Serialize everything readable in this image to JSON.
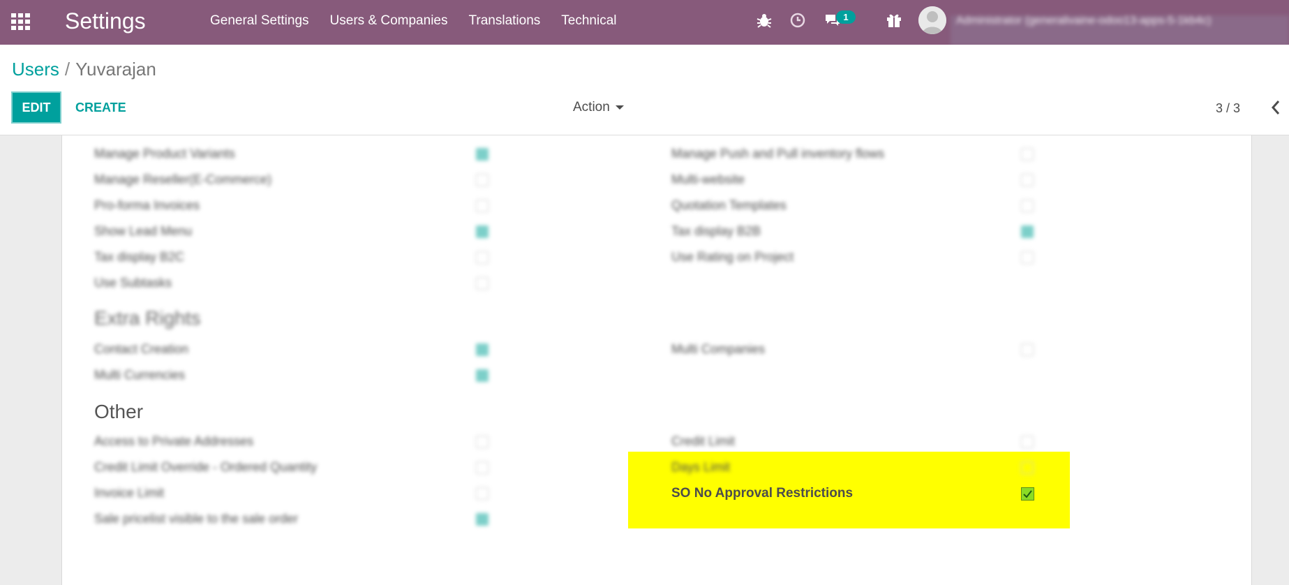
{
  "navbar": {
    "app_title": "Settings",
    "menu": [
      "General Settings",
      "Users & Companies",
      "Translations",
      "Technical"
    ],
    "chat_badge": "1",
    "user_name": "Administrator (generalivaine-odoo13-apps-5-1kb4c)"
  },
  "breadcrumb": {
    "parent": "Users",
    "separator": "/",
    "current": "Yuvarajan"
  },
  "toolbar": {
    "edit_label": "EDIT",
    "create_label": "CREATE",
    "action_label": "Action",
    "pager": "3 / 3"
  },
  "rights": {
    "left": [
      {
        "label": "Manage Product Variants",
        "checked": true
      },
      {
        "label": "Manage Reseller(E-Commerce)",
        "checked": false
      },
      {
        "label": "Pro-forma Invoices",
        "checked": false
      },
      {
        "label": "Show Lead Menu",
        "checked": true
      },
      {
        "label": "Tax display B2C",
        "checked": false
      },
      {
        "label": "Use Subtasks",
        "checked": false
      }
    ],
    "right": [
      {
        "label": "Manage Push and Pull inventory flows",
        "checked": false
      },
      {
        "label": "Multi-website",
        "checked": false
      },
      {
        "label": "Quotation Templates",
        "checked": false
      },
      {
        "label": "Tax display B2B",
        "checked": true
      },
      {
        "label": "Use Rating on Project",
        "checked": false
      }
    ]
  },
  "extra_rights": {
    "title": "Extra Rights",
    "left": [
      {
        "label": "Contact Creation",
        "checked": true
      },
      {
        "label": "Multi Currencies",
        "checked": true
      }
    ],
    "right": [
      {
        "label": "Multi Companies",
        "checked": false
      }
    ]
  },
  "other": {
    "title": "Other",
    "left": [
      {
        "label": "Access to Private Addresses",
        "checked": false
      },
      {
        "label": "Credit Limit Override - Ordered Quantity",
        "checked": false
      },
      {
        "label": "Invoice Limit",
        "checked": false
      },
      {
        "label": "Sale pricelist visible to the sale order",
        "checked": true
      }
    ],
    "right": [
      {
        "label": "Credit Limit",
        "checked": false
      },
      {
        "label": "Days Limit",
        "checked": false
      }
    ],
    "highlighted": {
      "label": "SO No Approval Restrictions",
      "checked": true
    }
  },
  "colors": {
    "navbar": "#875a7b",
    "accent": "#00a09d",
    "highlight": "#ffff00",
    "checked_green": "#8bdc24"
  }
}
